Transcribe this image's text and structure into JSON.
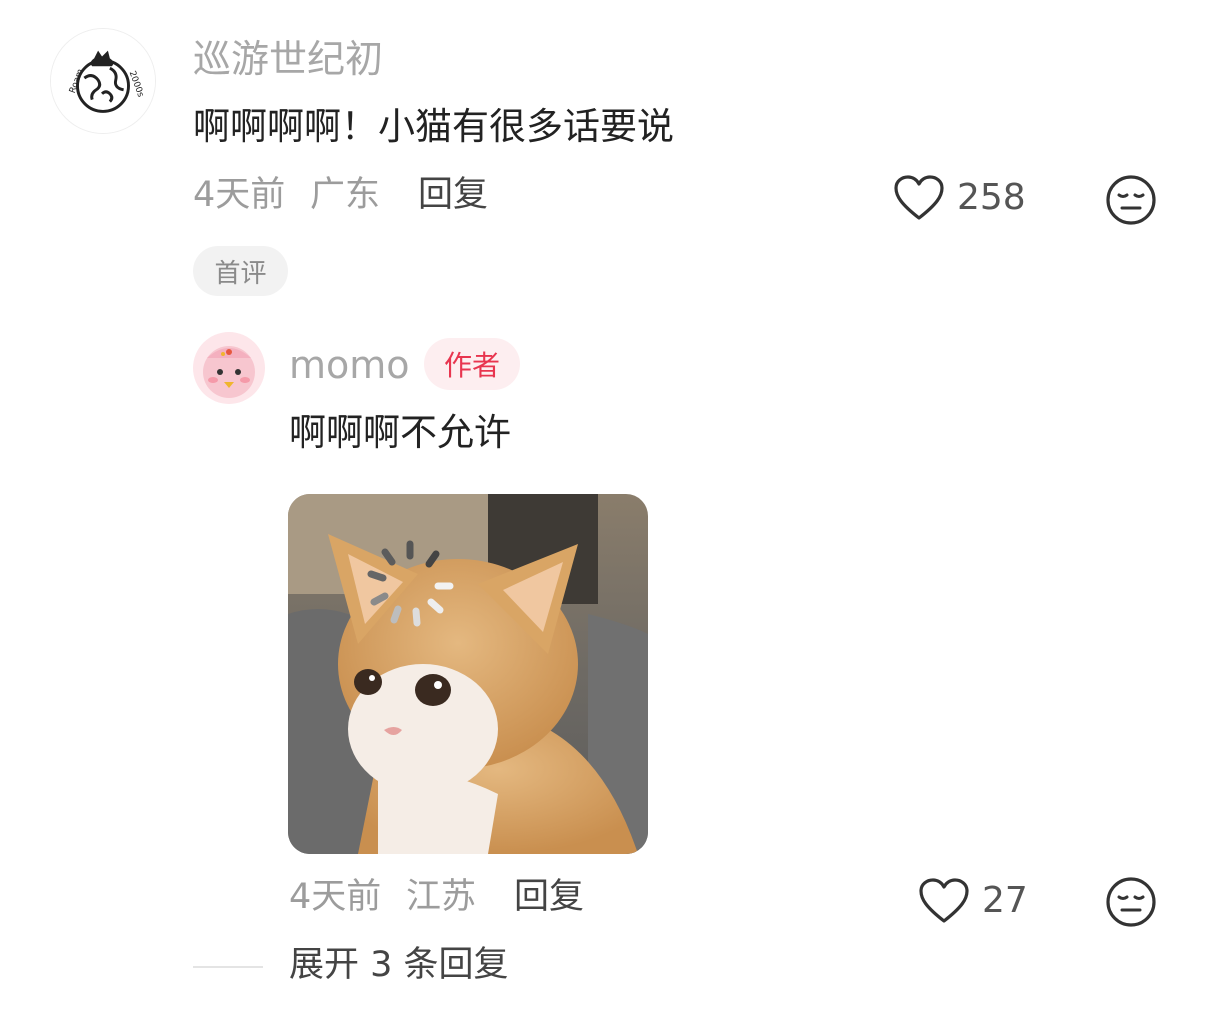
{
  "comment": {
    "username": "巡游世纪初",
    "avatar_icon": "roam-2000s-globe-icon",
    "avatar_text": "Roam 2000s",
    "text": "啊啊啊啊！小猫有很多话要说",
    "time": "4天前",
    "location": "广东",
    "reply_label": "回复",
    "like_count": "258",
    "badge": "首评"
  },
  "reply": {
    "username": "momo",
    "avatar_icon": "pink-bird-icon",
    "author_badge": "作者",
    "text": "啊啊啊不允许",
    "image_icon": "kitten-loading-image",
    "time": "4天前",
    "location": "江苏",
    "reply_label": "回复",
    "like_count": "27"
  },
  "expand_replies": "展开 3 条回复",
  "colors": {
    "author_badge_text": "#e8354f",
    "author_badge_bg": "#fdeef0",
    "meta_gray": "#9c9c9c"
  }
}
